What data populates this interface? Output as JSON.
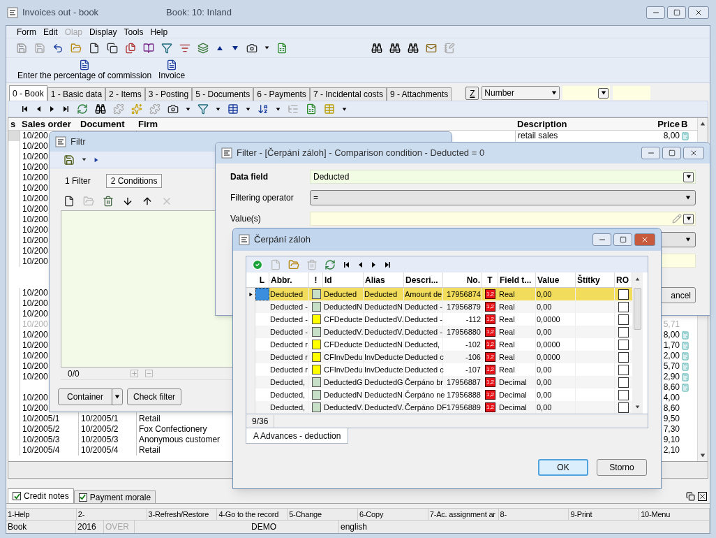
{
  "main_window": {
    "title": "Invoices out - book",
    "subtitle": "Book: 10: Inland"
  },
  "menu": [
    {
      "label": "Form",
      "disabled": false
    },
    {
      "label": "Edit",
      "disabled": false
    },
    {
      "label": "Olap",
      "disabled": true
    },
    {
      "label": "Display",
      "disabled": false
    },
    {
      "label": "Tools",
      "disabled": false
    },
    {
      "label": "Help",
      "disabled": false
    }
  ],
  "actions": [
    "Enter the percentage of commission",
    "Invoice"
  ],
  "tabs": [
    {
      "label": "0 - Book",
      "selected": true
    },
    {
      "label": "1 - Basic data",
      "selected": false
    },
    {
      "label": "2 - Items",
      "selected": false
    },
    {
      "label": "3 - Posting",
      "selected": false
    },
    {
      "label": "5 - Documents",
      "selected": false
    },
    {
      "label": "6 - Payments",
      "selected": false
    },
    {
      "label": "7 - Incidental costs",
      "selected": false
    },
    {
      "label": "9 - Attachments",
      "selected": false
    }
  ],
  "quick_search": {
    "key": "Z",
    "field": "Number"
  },
  "grid": {
    "columns": [
      "s",
      "Sales order",
      "Document",
      "Firm",
      "Description",
      "Price",
      "B"
    ],
    "rows": [
      {
        "kind": "entry",
        "sales_order": "10/200",
        "description": "retail sales",
        "price": "8,00",
        "calc": true,
        "dimmed": false
      },
      {
        "kind": "entry",
        "sales_order": "10/200",
        "dimmed": false
      },
      {
        "kind": "entry",
        "sales_order": "10/200",
        "dimmed": false
      },
      {
        "kind": "entry",
        "sales_order": "10/200",
        "dimmed": false
      },
      {
        "kind": "entry",
        "sales_order": "10/200",
        "dimmed": false
      },
      {
        "kind": "entry",
        "sales_order": "10/200",
        "dimmed": false
      },
      {
        "kind": "entry",
        "sales_order": "10/200",
        "dimmed": false
      },
      {
        "kind": "entry",
        "sales_order": "10/200",
        "dimmed": false
      },
      {
        "kind": "entry",
        "sales_order": "10/200",
        "dimmed": false
      },
      {
        "kind": "entry",
        "sales_order": "10/200",
        "dimmed": false
      },
      {
        "kind": "entry",
        "sales_order": "10/200",
        "dimmed": false
      },
      {
        "kind": "entry",
        "sales_order": "10/200",
        "dimmed": false
      },
      {
        "kind": "entry",
        "sales_order": "10/200",
        "dimmed": false
      },
      {
        "kind": "blank"
      },
      {
        "kind": "blank"
      },
      {
        "kind": "entry",
        "sales_order": "10/200",
        "dimmed": false
      },
      {
        "kind": "entry",
        "sales_order": "10/200",
        "dimmed": false
      },
      {
        "kind": "entry",
        "sales_order": "10/200",
        "dimmed": false
      },
      {
        "kind": "entry",
        "sales_order": "10/200",
        "price": "5,71",
        "calc": false,
        "dimmed": true
      },
      {
        "kind": "entry",
        "sales_order": "10/200",
        "price": "8,00",
        "calc": true,
        "dimmed": false
      },
      {
        "kind": "entry",
        "sales_order": "10/200",
        "price": "1,70",
        "calc": true,
        "dimmed": false
      },
      {
        "kind": "entry",
        "sales_order": "10/200",
        "price": "2,00",
        "calc": true,
        "dimmed": false
      },
      {
        "kind": "entry",
        "sales_order": "10/200",
        "price": "5,70",
        "calc": true,
        "dimmed": false
      },
      {
        "kind": "entry",
        "sales_order": "10/200",
        "price": "2,90",
        "calc": true,
        "dimmed": false
      },
      {
        "kind": "entry",
        "price": "8,60",
        "calc": true,
        "dimmed": false
      },
      {
        "kind": "entry",
        "sales_order": "10/200",
        "price": "4,00",
        "calc": false,
        "dimmed": false
      },
      {
        "kind": "entry",
        "sales_order": "10/200",
        "price": "8,60",
        "calc": false,
        "dimmed": false
      },
      {
        "kind": "entry",
        "sales_order": "10/2005/1",
        "document": "10/2005/1",
        "firm": "Retail",
        "price": "9,50",
        "calc": false,
        "dimmed": false
      },
      {
        "kind": "entry",
        "sales_order": "10/2005/2",
        "document": "10/2005/2",
        "firm": "Fox Confectionery",
        "price": "7,30",
        "calc": false,
        "dimmed": false
      },
      {
        "kind": "entry",
        "sales_order": "10/2005/3",
        "document": "10/2005/3",
        "firm": "Anonymous customer",
        "price": "9,10",
        "calc": false,
        "dimmed": false
      },
      {
        "kind": "entry",
        "sales_order": "10/2005/4",
        "document": "10/2005/4",
        "firm": "Retail",
        "price": "2,10",
        "calc": false,
        "dimmed": false
      }
    ]
  },
  "bottom_tabs": [
    {
      "label": "Credit notes",
      "checked": true,
      "selected": true
    },
    {
      "label": "Payment morale",
      "checked": true,
      "selected": false
    }
  ],
  "function_keys": [
    "1-Help",
    "2-",
    "3-Refresh/Restore",
    "4-Go to the record",
    "5-Change",
    "6-Copy",
    "7-Ac. assignment ar",
    "8-",
    "9-Print",
    "10-Menu"
  ],
  "status_bar": [
    {
      "text": "Book",
      "dimmed": false
    },
    {
      "text": "2016",
      "dimmed": false
    },
    {
      "text": "OVER",
      "dimmed": true
    },
    {
      "text": "DEMO",
      "dimmed": false
    },
    {
      "text": "english",
      "dimmed": false
    }
  ],
  "filtr_window": {
    "title": "Filtr",
    "tabs": [
      {
        "label": "1 Filter",
        "selected": false
      },
      {
        "label": "2 Conditions",
        "selected": true
      }
    ],
    "counter": "0/0",
    "buttons": [
      "Container",
      "Check filter"
    ]
  },
  "condition_window": {
    "title": "Filter - [Čerpání záloh] - Comparison condition - Deducted = 0",
    "fields": [
      {
        "label": "Data field",
        "value": "Deducted",
        "kind": "required"
      },
      {
        "label": "Filtering operator",
        "value": "=",
        "kind": "select"
      },
      {
        "label": "Value(s)",
        "kind": "value"
      }
    ],
    "cancel_button": "ancel"
  },
  "lookup_window": {
    "title": "Čerpání záloh",
    "columns": [
      "L",
      "Abbr.",
      "!",
      "Id",
      "Alias",
      "Descri...",
      "No.",
      "T",
      "Field t...",
      "Value",
      "Štítky",
      "RO"
    ],
    "rows": [
      {
        "selected": true,
        "abbr": "Deducted",
        "color": "#c6dfc6",
        "id": "Deducted",
        "alias": "Deducted",
        "description": "Amount de",
        "no": "17956874",
        "t": "1,2",
        "field_type": "Real",
        "value": "0,00",
        "ro": false
      },
      {
        "selected": false,
        "abbr": "Deducted -",
        "color": "#c6dfc6",
        "id": "DeductedN",
        "alias": "DeductedN",
        "description": "Deducted -",
        "no": "17956879",
        "t": "1,2",
        "field_type": "Real",
        "value": "0,00",
        "ro": false
      },
      {
        "selected": false,
        "abbr": "Deducted -",
        "color": "#ffff00",
        "id": "CFDeducte",
        "alias": "DeductedV.",
        "description": "Deducted -",
        "no": "-112",
        "t": "1,2",
        "field_type": "Real",
        "value": "0,0000",
        "ro": false
      },
      {
        "selected": false,
        "abbr": "Deducted -",
        "color": "#c6dfc6",
        "id": "DeductedV.",
        "alias": "DeductedV.",
        "description": "Deducted -",
        "no": "17956880",
        "t": "1,2",
        "field_type": "Real",
        "value": "0,00",
        "ro": false
      },
      {
        "selected": false,
        "abbr": "Deducted r",
        "color": "#ffff00",
        "id": "CFDeducte",
        "alias": "DeductedN",
        "description": "Deducted,",
        "no": "-102",
        "t": "1,2",
        "field_type": "Real",
        "value": "0,0000",
        "ro": false
      },
      {
        "selected": false,
        "abbr": "Deducted r",
        "color": "#ffff00",
        "id": "CFInvDedu",
        "alias": "InvDeducte",
        "description": "Deducted c",
        "no": "-106",
        "t": "1,2",
        "field_type": "Real",
        "value": "0,0000",
        "ro": false
      },
      {
        "selected": false,
        "abbr": "Deducted r",
        "color": "#ffff00",
        "id": "CFInvDedu",
        "alias": "InvDeducte",
        "description": "Deducted c",
        "no": "-107",
        "t": "1,2",
        "field_type": "Real",
        "value": "0,00",
        "ro": false
      },
      {
        "selected": false,
        "abbr": "Deducted,",
        "color": "#c6dfc6",
        "id": "DeductedG",
        "alias": "DeductedG",
        "description": "Čerpáno br",
        "no": "17956887",
        "t": "1,2",
        "field_type": "Decimal",
        "value": "0,00",
        "ro": false
      },
      {
        "selected": false,
        "abbr": "Deducted,",
        "color": "#c6dfc6",
        "id": "DeductedN",
        "alias": "DeductedN",
        "description": "Čerpáno ne",
        "no": "17956888",
        "t": "1,2",
        "field_type": "Decimal",
        "value": "0,00",
        "ro": false
      },
      {
        "selected": false,
        "abbr": "Deducted,",
        "color": "#c6dfc6",
        "id": "DeductedV.",
        "alias": "DeductedV.",
        "description": "Čerpáno DF",
        "no": "17956889",
        "t": "1,2",
        "field_type": "Decimal",
        "value": "0,00",
        "ro": false
      }
    ],
    "counter": "9/36",
    "tab": "A Advances - deduction",
    "buttons": [
      "OK",
      "Storno"
    ]
  }
}
